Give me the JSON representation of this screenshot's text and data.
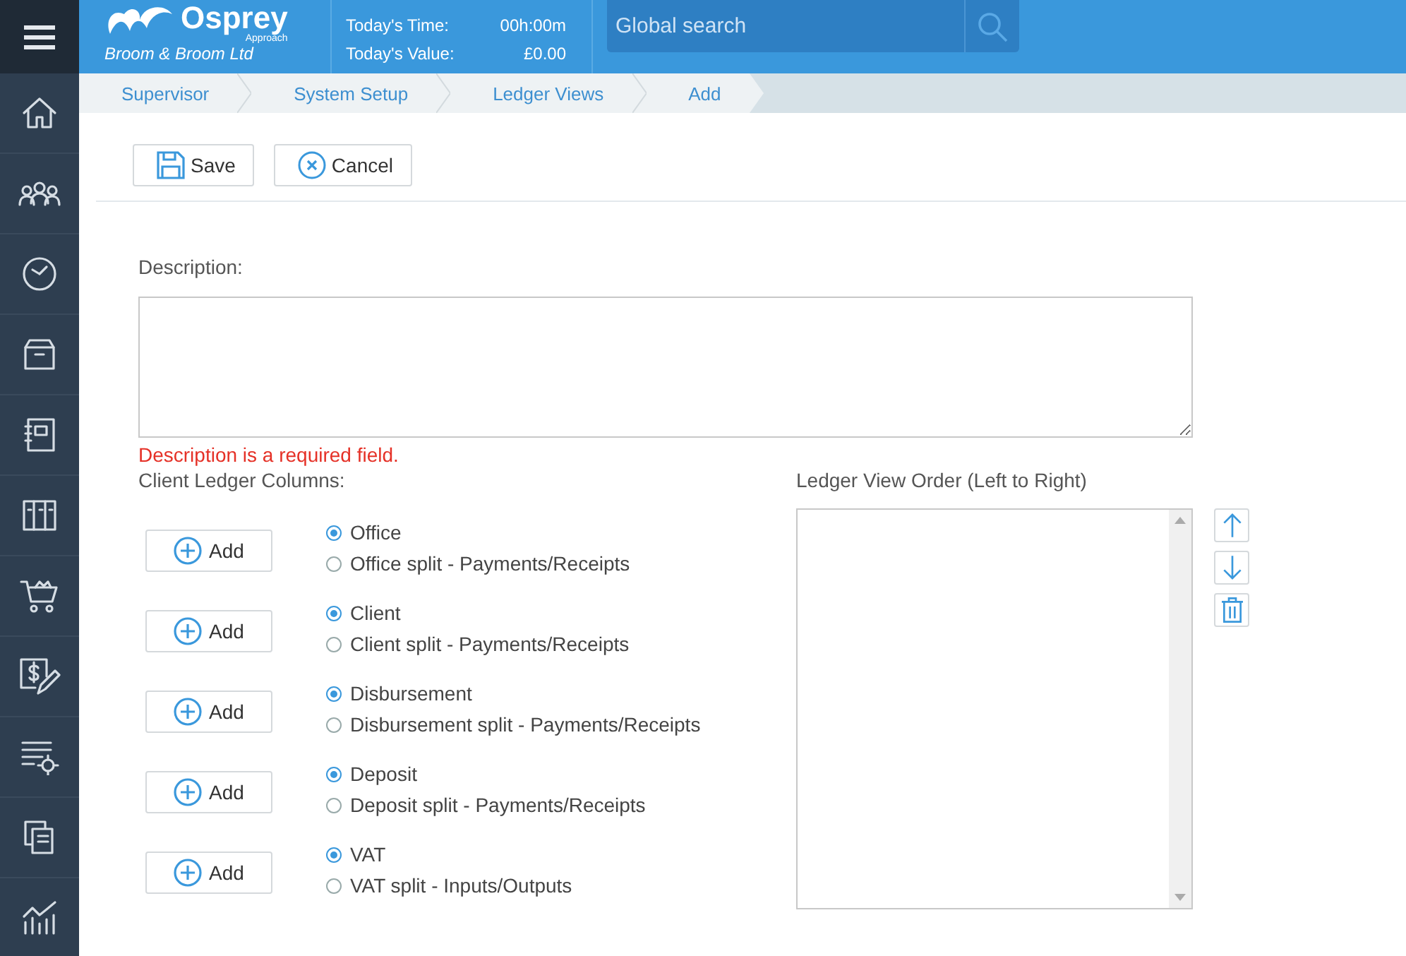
{
  "header": {
    "logo": "Osprey",
    "logo_sub": "Approach",
    "company": "Broom & Broom Ltd",
    "stats": [
      {
        "label": "Today's Time:",
        "value": "00h:00m"
      },
      {
        "label": "Today's Value:",
        "value": "£0.00"
      }
    ],
    "search": {
      "placeholder": "Global search"
    }
  },
  "breadcrumbs": [
    "Supervisor",
    "System Setup",
    "Ledger Views",
    "Add"
  ],
  "toolbar": [
    {
      "kind": "save",
      "label": "Save"
    },
    {
      "kind": "cancel",
      "label": "Cancel"
    }
  ],
  "form": {
    "description_label": "Description:",
    "error": "Description is a required field.",
    "columns_label": "Client Ledger Columns:",
    "columns": [
      {
        "add": "Add",
        "options": [
          {
            "label": "Office",
            "selected": true
          },
          {
            "label": "Office split - Payments/Receipts",
            "selected": false
          }
        ]
      },
      {
        "add": "Add",
        "options": [
          {
            "label": "Client",
            "selected": true
          },
          {
            "label": "Client split - Payments/Receipts",
            "selected": false
          }
        ]
      },
      {
        "add": "Add",
        "options": [
          {
            "label": "Disbursement",
            "selected": true
          },
          {
            "label": "Disbursement split - Payments/Receipts",
            "selected": false
          }
        ]
      },
      {
        "add": "Add",
        "options": [
          {
            "label": "Deposit",
            "selected": true
          },
          {
            "label": "Deposit split - Payments/Receipts",
            "selected": false
          }
        ]
      },
      {
        "add": "Add",
        "options": [
          {
            "label": "VAT",
            "selected": true
          },
          {
            "label": "VAT split - Inputs/Outputs",
            "selected": false
          }
        ]
      }
    ],
    "order_label": "Ledger View Order (Left to Right)",
    "order_actions": [
      {
        "kind": "up"
      },
      {
        "kind": "down"
      },
      {
        "kind": "delete"
      }
    ]
  }
}
